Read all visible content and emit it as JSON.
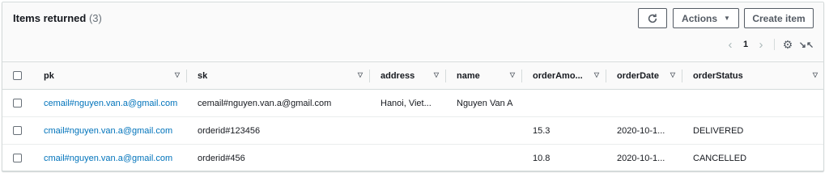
{
  "header": {
    "title": "Items returned",
    "count": "(3)",
    "actions_label": "Actions",
    "create_label": "Create item"
  },
  "pagination": {
    "current_page": "1"
  },
  "icons": {
    "refresh": "refresh-icon",
    "caret": "caret-down-icon",
    "prev": "chevron-left-icon",
    "next": "chevron-right-icon",
    "settings": "gear-icon",
    "collapse": "collapse-icon",
    "sort": "sort-down-icon"
  },
  "colors": {
    "link": "#0073bb",
    "border": "#d5dbdb",
    "header_bg": "#fafafa",
    "text": "#16191f",
    "muted": "#687078"
  },
  "columns": [
    "pk",
    "sk",
    "address",
    "name",
    "orderAmo...",
    "orderDate",
    "orderStatus"
  ],
  "rows": [
    [
      "cemail#nguyen.van.a@gmail.com",
      "cemail#nguyen.van.a@gmail.com",
      "Hanoi, Viet...",
      "Nguyen Van A",
      "",
      "",
      ""
    ],
    [
      "cmail#nguyen.van.a@gmail.com",
      "orderid#123456",
      "",
      "",
      "15.3",
      "2020-10-1...",
      "DELIVERED"
    ],
    [
      "cmail#nguyen.van.a@gmail.com",
      "orderid#456",
      "",
      "",
      "10.8",
      "2020-10-1...",
      "CANCELLED"
    ]
  ]
}
